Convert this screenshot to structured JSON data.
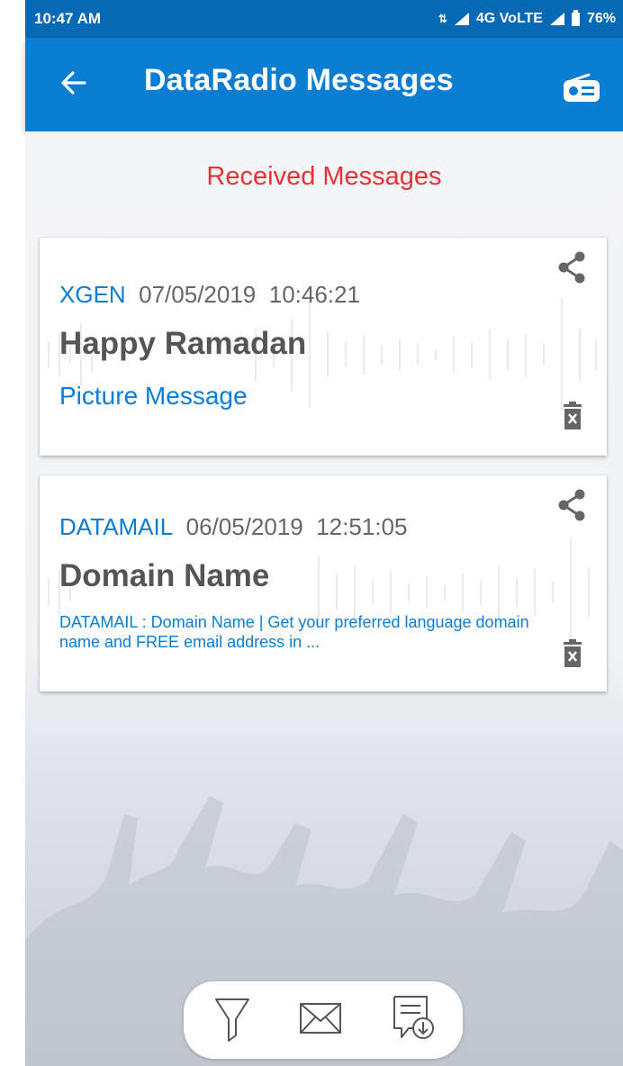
{
  "status": {
    "time": "10:47 AM",
    "network": "4G VoLTE",
    "battery": "76%"
  },
  "appbar": {
    "title": "DataRadio Messages",
    "back_icon": "arrow-left-icon",
    "radio_icon": "radio-icon"
  },
  "main": {
    "heading": "Received Messages"
  },
  "messages": [
    {
      "sender": "XGEN",
      "date": "07/05/2019",
      "time": "10:46:21",
      "subject": "Happy Ramadan",
      "body": "Picture Message"
    },
    {
      "sender": "DATAMAIL",
      "date": "06/05/2019",
      "time": "12:51:05",
      "subject": "Domain Name",
      "body": "DATAMAIL : Domain Name | Get your preferred language domain name and FREE email address in ..."
    }
  ],
  "bottom_bar": {
    "icons": [
      "filter-icon",
      "envelope-icon",
      "download-message-icon"
    ]
  },
  "colors": {
    "appbar": "#0b7dd2",
    "statusbar": "#0669b6",
    "heading": "#e8323a",
    "link": "#0b7dd2"
  }
}
